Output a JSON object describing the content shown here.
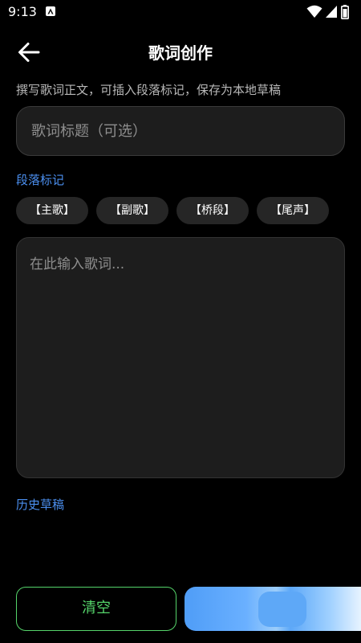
{
  "status_bar": {
    "time": "9:13"
  },
  "header": {
    "title": "歌词创作"
  },
  "subtitle": "撰写歌词正文，可插入段落标记，保存为本地草稿",
  "title_input": {
    "placeholder": "歌词标题（可选）",
    "value": ""
  },
  "markers": {
    "label": "段落标记",
    "items": [
      "【主歌】",
      "【副歌】",
      "【桥段】",
      "【尾声】"
    ]
  },
  "lyrics": {
    "placeholder": "在此输入歌词...",
    "value": ""
  },
  "history": {
    "label": "历史草稿"
  },
  "actions": {
    "clear_label": "清空",
    "save_label": ""
  },
  "colors": {
    "accent_blue": "#4b8fef",
    "accent_green": "#55d46a",
    "background": "#000000",
    "surface": "#1d1d1d"
  },
  "icons": {
    "back": "arrow-left-icon",
    "wifi": "wifi-icon",
    "signal": "signal-icon",
    "battery": "battery-icon",
    "app_notification": "app-notification-icon"
  }
}
